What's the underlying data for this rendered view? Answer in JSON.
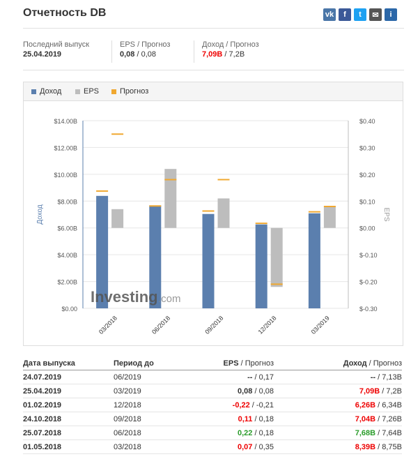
{
  "title": "Отчетность DB",
  "share_icons": [
    {
      "name": "vk-icon",
      "glyph": "vk",
      "color": "#4a76a8"
    },
    {
      "name": "facebook-icon",
      "glyph": "f",
      "color": "#3b5998"
    },
    {
      "name": "twitter-icon",
      "glyph": "t",
      "color": "#1da1f2"
    },
    {
      "name": "mail-icon",
      "glyph": "✉",
      "color": "#555555"
    },
    {
      "name": "info-icon",
      "glyph": "i",
      "color": "#2b67a8"
    }
  ],
  "summary": {
    "last_release_label": "Последний выпуск",
    "last_release_value": "25.04.2019",
    "eps_label": "EPS / Прогноз",
    "eps_actual": "0,08",
    "eps_forecast": " / 0,08",
    "rev_label": "Доход / Прогноз",
    "rev_actual": "7,09B",
    "rev_forecast": " / 7,2B"
  },
  "colors": {
    "revenue": "#5b7fae",
    "eps": "#bdbdbd",
    "forecast": "#f0a830",
    "red": "#ee0000",
    "green": "#2a9c2a"
  },
  "watermark": {
    "brand": "Investing",
    "suffix": ".com"
  },
  "chart_data": {
    "type": "bar",
    "legend": [
      "Доход",
      "EPS",
      "Прогноз"
    ],
    "categories": [
      "03/2018",
      "06/2018",
      "09/2018",
      "12/2018",
      "03/2019"
    ],
    "y_left_label": "Доход",
    "y_right_label": "EPS",
    "y_left_ticks": [
      "$14.00B",
      "$12.00B",
      "$10.00B",
      "$8.00B",
      "$6.00B",
      "$4.00B",
      "$2.00B",
      "$0.00"
    ],
    "y_right_ticks": [
      "$0.40",
      "$0.30",
      "$0.20",
      "$0.10",
      "$0.00",
      "$-0.10",
      "$-0.20",
      "$-0.30"
    ],
    "y_left_range": [
      0,
      14
    ],
    "y_right_range": [
      -0.3,
      0.4
    ],
    "series": [
      {
        "name": "Доход",
        "values": [
          8.39,
          7.68,
          7.04,
          6.26,
          7.09
        ],
        "forecast": [
          8.75,
          7.64,
          7.26,
          6.34,
          7.2
        ]
      },
      {
        "name": "EPS",
        "values": [
          0.07,
          0.22,
          0.11,
          -0.22,
          0.08
        ],
        "forecast": [
          0.35,
          0.18,
          0.18,
          -0.21,
          0.08
        ]
      }
    ]
  },
  "table": {
    "headers": {
      "date": "Дата выпуска",
      "period": "Период до",
      "eps": "EPS",
      "eps_forecast": " / Прогноз",
      "rev": "Доход",
      "rev_forecast": " / Прогноз"
    },
    "rows": [
      {
        "date": "24.07.2019",
        "period": "06/2019",
        "eps": "--",
        "eps_class": "",
        "eps_f": " / 0,17",
        "rev": "--",
        "rev_class": "",
        "rev_f": " / 7,13B"
      },
      {
        "date": "25.04.2019",
        "period": "03/2019",
        "eps": "0,08",
        "eps_class": "",
        "eps_f": " / 0,08",
        "rev": "7,09B",
        "rev_class": "red",
        "rev_f": " / 7,2B"
      },
      {
        "date": "01.02.2019",
        "period": "12/2018",
        "eps": "-0,22",
        "eps_class": "red",
        "eps_f": " / -0,21",
        "rev": "6,26B",
        "rev_class": "red",
        "rev_f": " / 6,34B"
      },
      {
        "date": "24.10.2018",
        "period": "09/2018",
        "eps": "0,11",
        "eps_class": "red",
        "eps_f": " / 0,18",
        "rev": "7,04B",
        "rev_class": "red",
        "rev_f": " / 7,26B"
      },
      {
        "date": "25.07.2018",
        "period": "06/2018",
        "eps": "0,22",
        "eps_class": "green",
        "eps_f": " / 0,18",
        "rev": "7,68B",
        "rev_class": "green",
        "rev_f": " / 7,64B"
      },
      {
        "date": "01.05.2018",
        "period": "03/2018",
        "eps": "0,07",
        "eps_class": "red",
        "eps_f": " / 0,35",
        "rev": "8,39B",
        "rev_class": "red",
        "rev_f": " / 8,75B"
      }
    ]
  }
}
